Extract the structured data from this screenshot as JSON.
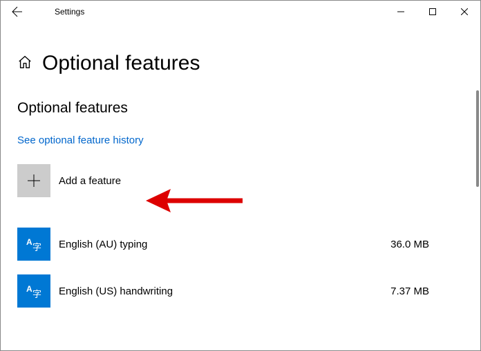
{
  "titlebar": {
    "app": "Settings"
  },
  "page": {
    "heading": "Optional features",
    "subheading": "Optional features"
  },
  "link": {
    "history": "See optional feature history"
  },
  "add": {
    "label": "Add a feature"
  },
  "features": [
    {
      "name": "English (AU) typing",
      "size": "36.0 MB"
    },
    {
      "name": "English (US) handwriting",
      "size": "7.37 MB"
    }
  ]
}
